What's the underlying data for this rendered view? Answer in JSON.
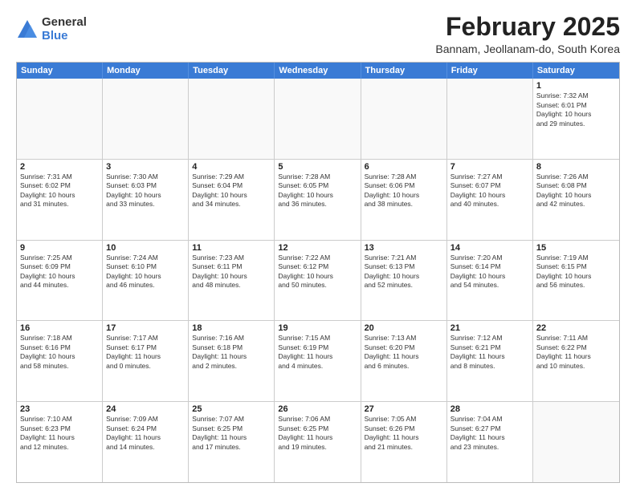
{
  "logo": {
    "general": "General",
    "blue": "Blue"
  },
  "title": "February 2025",
  "subtitle": "Bannam, Jeollanam-do, South Korea",
  "headers": [
    "Sunday",
    "Monday",
    "Tuesday",
    "Wednesday",
    "Thursday",
    "Friday",
    "Saturday"
  ],
  "weeks": [
    [
      {
        "day": "",
        "info": "",
        "empty": true
      },
      {
        "day": "",
        "info": "",
        "empty": true
      },
      {
        "day": "",
        "info": "",
        "empty": true
      },
      {
        "day": "",
        "info": "",
        "empty": true
      },
      {
        "day": "",
        "info": "",
        "empty": true
      },
      {
        "day": "",
        "info": "",
        "empty": true
      },
      {
        "day": "1",
        "info": "Sunrise: 7:32 AM\nSunset: 6:01 PM\nDaylight: 10 hours\nand 29 minutes."
      }
    ],
    [
      {
        "day": "2",
        "info": "Sunrise: 7:31 AM\nSunset: 6:02 PM\nDaylight: 10 hours\nand 31 minutes."
      },
      {
        "day": "3",
        "info": "Sunrise: 7:30 AM\nSunset: 6:03 PM\nDaylight: 10 hours\nand 33 minutes."
      },
      {
        "day": "4",
        "info": "Sunrise: 7:29 AM\nSunset: 6:04 PM\nDaylight: 10 hours\nand 34 minutes."
      },
      {
        "day": "5",
        "info": "Sunrise: 7:28 AM\nSunset: 6:05 PM\nDaylight: 10 hours\nand 36 minutes."
      },
      {
        "day": "6",
        "info": "Sunrise: 7:28 AM\nSunset: 6:06 PM\nDaylight: 10 hours\nand 38 minutes."
      },
      {
        "day": "7",
        "info": "Sunrise: 7:27 AM\nSunset: 6:07 PM\nDaylight: 10 hours\nand 40 minutes."
      },
      {
        "day": "8",
        "info": "Sunrise: 7:26 AM\nSunset: 6:08 PM\nDaylight: 10 hours\nand 42 minutes."
      }
    ],
    [
      {
        "day": "9",
        "info": "Sunrise: 7:25 AM\nSunset: 6:09 PM\nDaylight: 10 hours\nand 44 minutes."
      },
      {
        "day": "10",
        "info": "Sunrise: 7:24 AM\nSunset: 6:10 PM\nDaylight: 10 hours\nand 46 minutes."
      },
      {
        "day": "11",
        "info": "Sunrise: 7:23 AM\nSunset: 6:11 PM\nDaylight: 10 hours\nand 48 minutes."
      },
      {
        "day": "12",
        "info": "Sunrise: 7:22 AM\nSunset: 6:12 PM\nDaylight: 10 hours\nand 50 minutes."
      },
      {
        "day": "13",
        "info": "Sunrise: 7:21 AM\nSunset: 6:13 PM\nDaylight: 10 hours\nand 52 minutes."
      },
      {
        "day": "14",
        "info": "Sunrise: 7:20 AM\nSunset: 6:14 PM\nDaylight: 10 hours\nand 54 minutes."
      },
      {
        "day": "15",
        "info": "Sunrise: 7:19 AM\nSunset: 6:15 PM\nDaylight: 10 hours\nand 56 minutes."
      }
    ],
    [
      {
        "day": "16",
        "info": "Sunrise: 7:18 AM\nSunset: 6:16 PM\nDaylight: 10 hours\nand 58 minutes."
      },
      {
        "day": "17",
        "info": "Sunrise: 7:17 AM\nSunset: 6:17 PM\nDaylight: 11 hours\nand 0 minutes."
      },
      {
        "day": "18",
        "info": "Sunrise: 7:16 AM\nSunset: 6:18 PM\nDaylight: 11 hours\nand 2 minutes."
      },
      {
        "day": "19",
        "info": "Sunrise: 7:15 AM\nSunset: 6:19 PM\nDaylight: 11 hours\nand 4 minutes."
      },
      {
        "day": "20",
        "info": "Sunrise: 7:13 AM\nSunset: 6:20 PM\nDaylight: 11 hours\nand 6 minutes."
      },
      {
        "day": "21",
        "info": "Sunrise: 7:12 AM\nSunset: 6:21 PM\nDaylight: 11 hours\nand 8 minutes."
      },
      {
        "day": "22",
        "info": "Sunrise: 7:11 AM\nSunset: 6:22 PM\nDaylight: 11 hours\nand 10 minutes."
      }
    ],
    [
      {
        "day": "23",
        "info": "Sunrise: 7:10 AM\nSunset: 6:23 PM\nDaylight: 11 hours\nand 12 minutes."
      },
      {
        "day": "24",
        "info": "Sunrise: 7:09 AM\nSunset: 6:24 PM\nDaylight: 11 hours\nand 14 minutes."
      },
      {
        "day": "25",
        "info": "Sunrise: 7:07 AM\nSunset: 6:25 PM\nDaylight: 11 hours\nand 17 minutes."
      },
      {
        "day": "26",
        "info": "Sunrise: 7:06 AM\nSunset: 6:25 PM\nDaylight: 11 hours\nand 19 minutes."
      },
      {
        "day": "27",
        "info": "Sunrise: 7:05 AM\nSunset: 6:26 PM\nDaylight: 11 hours\nand 21 minutes."
      },
      {
        "day": "28",
        "info": "Sunrise: 7:04 AM\nSunset: 6:27 PM\nDaylight: 11 hours\nand 23 minutes."
      },
      {
        "day": "",
        "info": "",
        "empty": true
      }
    ]
  ]
}
